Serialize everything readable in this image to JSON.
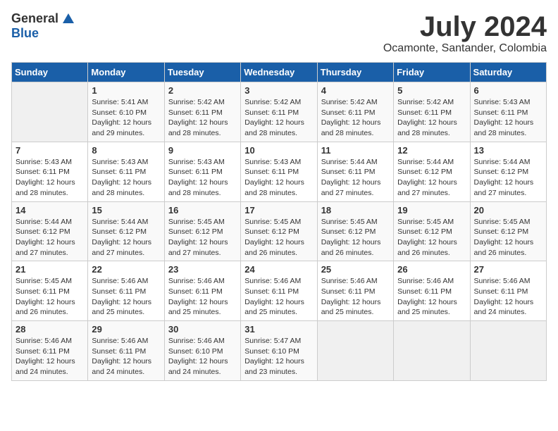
{
  "header": {
    "logo_general": "General",
    "logo_blue": "Blue",
    "month_title": "July 2024",
    "location": "Ocamonte, Santander, Colombia"
  },
  "days_of_week": [
    "Sunday",
    "Monday",
    "Tuesday",
    "Wednesday",
    "Thursday",
    "Friday",
    "Saturday"
  ],
  "weeks": [
    [
      {
        "day": "",
        "info": ""
      },
      {
        "day": "1",
        "info": "Sunrise: 5:41 AM\nSunset: 6:10 PM\nDaylight: 12 hours\nand 29 minutes."
      },
      {
        "day": "2",
        "info": "Sunrise: 5:42 AM\nSunset: 6:11 PM\nDaylight: 12 hours\nand 28 minutes."
      },
      {
        "day": "3",
        "info": "Sunrise: 5:42 AM\nSunset: 6:11 PM\nDaylight: 12 hours\nand 28 minutes."
      },
      {
        "day": "4",
        "info": "Sunrise: 5:42 AM\nSunset: 6:11 PM\nDaylight: 12 hours\nand 28 minutes."
      },
      {
        "day": "5",
        "info": "Sunrise: 5:42 AM\nSunset: 6:11 PM\nDaylight: 12 hours\nand 28 minutes."
      },
      {
        "day": "6",
        "info": "Sunrise: 5:43 AM\nSunset: 6:11 PM\nDaylight: 12 hours\nand 28 minutes."
      }
    ],
    [
      {
        "day": "7",
        "info": "Sunrise: 5:43 AM\nSunset: 6:11 PM\nDaylight: 12 hours\nand 28 minutes."
      },
      {
        "day": "8",
        "info": "Sunrise: 5:43 AM\nSunset: 6:11 PM\nDaylight: 12 hours\nand 28 minutes."
      },
      {
        "day": "9",
        "info": "Sunrise: 5:43 AM\nSunset: 6:11 PM\nDaylight: 12 hours\nand 28 minutes."
      },
      {
        "day": "10",
        "info": "Sunrise: 5:43 AM\nSunset: 6:11 PM\nDaylight: 12 hours\nand 28 minutes."
      },
      {
        "day": "11",
        "info": "Sunrise: 5:44 AM\nSunset: 6:11 PM\nDaylight: 12 hours\nand 27 minutes."
      },
      {
        "day": "12",
        "info": "Sunrise: 5:44 AM\nSunset: 6:12 PM\nDaylight: 12 hours\nand 27 minutes."
      },
      {
        "day": "13",
        "info": "Sunrise: 5:44 AM\nSunset: 6:12 PM\nDaylight: 12 hours\nand 27 minutes."
      }
    ],
    [
      {
        "day": "14",
        "info": "Sunrise: 5:44 AM\nSunset: 6:12 PM\nDaylight: 12 hours\nand 27 minutes."
      },
      {
        "day": "15",
        "info": "Sunrise: 5:44 AM\nSunset: 6:12 PM\nDaylight: 12 hours\nand 27 minutes."
      },
      {
        "day": "16",
        "info": "Sunrise: 5:45 AM\nSunset: 6:12 PM\nDaylight: 12 hours\nand 27 minutes."
      },
      {
        "day": "17",
        "info": "Sunrise: 5:45 AM\nSunset: 6:12 PM\nDaylight: 12 hours\nand 26 minutes."
      },
      {
        "day": "18",
        "info": "Sunrise: 5:45 AM\nSunset: 6:12 PM\nDaylight: 12 hours\nand 26 minutes."
      },
      {
        "day": "19",
        "info": "Sunrise: 5:45 AM\nSunset: 6:12 PM\nDaylight: 12 hours\nand 26 minutes."
      },
      {
        "day": "20",
        "info": "Sunrise: 5:45 AM\nSunset: 6:12 PM\nDaylight: 12 hours\nand 26 minutes."
      }
    ],
    [
      {
        "day": "21",
        "info": "Sunrise: 5:45 AM\nSunset: 6:11 PM\nDaylight: 12 hours\nand 26 minutes."
      },
      {
        "day": "22",
        "info": "Sunrise: 5:46 AM\nSunset: 6:11 PM\nDaylight: 12 hours\nand 25 minutes."
      },
      {
        "day": "23",
        "info": "Sunrise: 5:46 AM\nSunset: 6:11 PM\nDaylight: 12 hours\nand 25 minutes."
      },
      {
        "day": "24",
        "info": "Sunrise: 5:46 AM\nSunset: 6:11 PM\nDaylight: 12 hours\nand 25 minutes."
      },
      {
        "day": "25",
        "info": "Sunrise: 5:46 AM\nSunset: 6:11 PM\nDaylight: 12 hours\nand 25 minutes."
      },
      {
        "day": "26",
        "info": "Sunrise: 5:46 AM\nSunset: 6:11 PM\nDaylight: 12 hours\nand 25 minutes."
      },
      {
        "day": "27",
        "info": "Sunrise: 5:46 AM\nSunset: 6:11 PM\nDaylight: 12 hours\nand 24 minutes."
      }
    ],
    [
      {
        "day": "28",
        "info": "Sunrise: 5:46 AM\nSunset: 6:11 PM\nDaylight: 12 hours\nand 24 minutes."
      },
      {
        "day": "29",
        "info": "Sunrise: 5:46 AM\nSunset: 6:11 PM\nDaylight: 12 hours\nand 24 minutes."
      },
      {
        "day": "30",
        "info": "Sunrise: 5:46 AM\nSunset: 6:10 PM\nDaylight: 12 hours\nand 24 minutes."
      },
      {
        "day": "31",
        "info": "Sunrise: 5:47 AM\nSunset: 6:10 PM\nDaylight: 12 hours\nand 23 minutes."
      },
      {
        "day": "",
        "info": ""
      },
      {
        "day": "",
        "info": ""
      },
      {
        "day": "",
        "info": ""
      }
    ]
  ]
}
